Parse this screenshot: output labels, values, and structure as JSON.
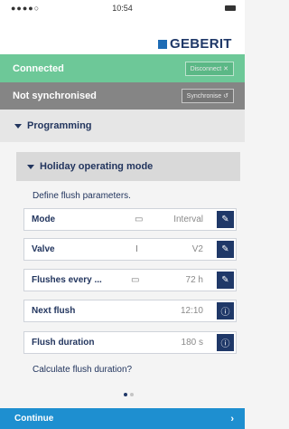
{
  "status_bar": {
    "signal": "●●●●○ ",
    "time": "10:54"
  },
  "brand": {
    "logo_text": "GEBERIT"
  },
  "connection": {
    "label": "Connected",
    "button": "Disconnect ✕"
  },
  "sync": {
    "label": "Not synchronised",
    "button": "Synchronise ↺"
  },
  "programming": {
    "label": "Programming"
  },
  "holiday": {
    "label": "Holiday operating mode"
  },
  "define_text": "Define flush parameters.",
  "params": [
    {
      "label": "Mode",
      "value": "Interval",
      "glyph": "▭"
    },
    {
      "label": "Valve",
      "value": "V2",
      "glyph": "I"
    },
    {
      "label": "Flushes every ...",
      "value": "72 h",
      "glyph": "▭"
    },
    {
      "label": "Next flush",
      "value": "12:10",
      "glyph": ""
    },
    {
      "label": "Flush duration",
      "value": "180 s",
      "glyph": ""
    }
  ],
  "calc_link": "Calculate flush duration?",
  "pager": {
    "pages": 2,
    "current": 1
  },
  "continue": {
    "label": "Continue",
    "arrow": "›"
  },
  "colors": {
    "connected_green": "#6dc898",
    "not_sync_gray": "#858585",
    "brand_blue": "#1f3868",
    "accent_blue": "#1e8fd0"
  }
}
